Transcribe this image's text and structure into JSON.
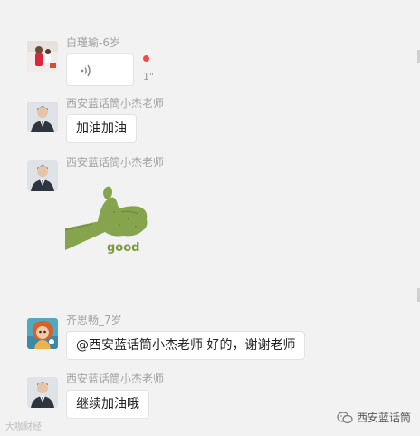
{
  "messages": [
    {
      "sender": "白瑾瑜-6岁",
      "type": "voice",
      "duration": "1\"",
      "unread": true
    },
    {
      "sender": "西安蓝话筒小杰老师",
      "type": "text",
      "text": "加油加油"
    },
    {
      "sender": "西安蓝话筒小杰老师",
      "type": "sticker",
      "sticker_text": "good"
    },
    {
      "sender": "齐思畅_7岁",
      "type": "text",
      "text": "@西安蓝话筒小杰老师 好的，谢谢老师"
    },
    {
      "sender": "西安蓝话筒小杰老师",
      "type": "text",
      "text": "继续加油哦"
    }
  ],
  "watermark": {
    "left": "大咖财经",
    "right": "西安蓝话筒"
  },
  "colors": {
    "background": "#f2f2f2",
    "bubble": "#ffffff",
    "sender": "#a3a3a3",
    "unread_dot": "#f24a4a",
    "sticker_green": "#7e9a45"
  }
}
